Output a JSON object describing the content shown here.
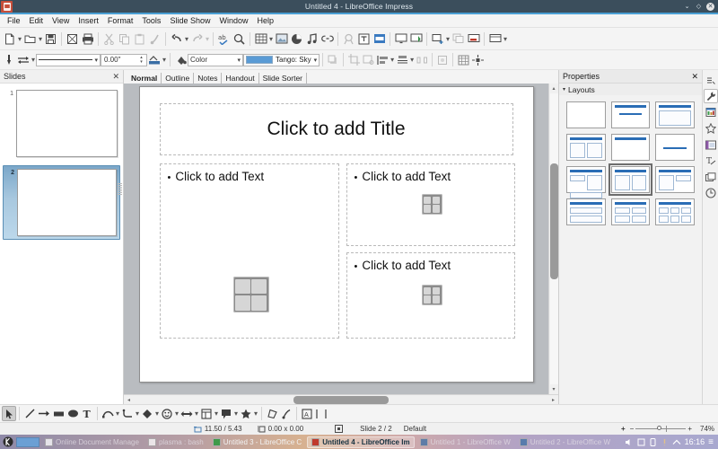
{
  "window": {
    "title": "Untitled 4 - LibreOffice Impress",
    "app_icon": "impress-document-icon",
    "controls": {
      "minimize": "⌄",
      "maximize": "◇",
      "close": "✕"
    }
  },
  "menubar": {
    "items": [
      {
        "label": "File"
      },
      {
        "label": "Edit"
      },
      {
        "label": "View"
      },
      {
        "label": "Insert"
      },
      {
        "label": "Format"
      },
      {
        "label": "Tools"
      },
      {
        "label": "Slide Show"
      },
      {
        "label": "Window"
      },
      {
        "label": "Help"
      }
    ]
  },
  "toolbar_main": {
    "items": [
      {
        "name": "new-document",
        "dropdown": true
      },
      {
        "name": "open-document",
        "dropdown": true
      },
      {
        "name": "save-document",
        "dropdown": false
      },
      {
        "name": "export-pdf",
        "dropdown": false
      },
      {
        "name": "print",
        "dropdown": false
      },
      {
        "name": "cut",
        "disabled": true
      },
      {
        "name": "copy",
        "disabled": true
      },
      {
        "name": "paste",
        "disabled": true
      },
      {
        "name": "clone-formatting",
        "disabled": true
      },
      {
        "name": "undo",
        "dropdown": true
      },
      {
        "name": "redo",
        "dropdown": true,
        "disabled": true
      },
      {
        "name": "spelling"
      },
      {
        "name": "find-replace"
      },
      {
        "name": "insert-table",
        "dropdown": true
      },
      {
        "name": "insert-image"
      },
      {
        "name": "insert-chart"
      },
      {
        "name": "insert-audio-video"
      },
      {
        "name": "insert-hyperlink"
      },
      {
        "name": "insert-special-character",
        "disabled": true
      },
      {
        "name": "insert-text-box"
      },
      {
        "name": "insert-header-footer"
      },
      {
        "name": "start-from-first-slide"
      },
      {
        "name": "start-from-current-slide"
      },
      {
        "name": "new-slide",
        "dropdown": true
      },
      {
        "name": "duplicate-slide",
        "disabled": true
      },
      {
        "name": "delete-slide"
      },
      {
        "name": "slide-layout",
        "dropdown": true
      }
    ]
  },
  "toolbar_line_fill": {
    "line_style_value": "—————",
    "line_width_value": "0.00\"",
    "fill_type_value": "Color",
    "fill_color_name": "Tango: Sky",
    "fill_color_hex": "#5a9bd5",
    "items": [
      {
        "name": "line-endpoint-style"
      },
      {
        "name": "line-arrow-style",
        "dropdown": true
      },
      {
        "name": "line-corner-style",
        "dropdown": true
      },
      {
        "name": "shadow"
      },
      {
        "name": "crop-image"
      },
      {
        "name": "filter"
      },
      {
        "name": "rotate"
      },
      {
        "name": "align-objects",
        "dropdown": true
      },
      {
        "name": "arrange-objects",
        "dropdown": true
      },
      {
        "name": "distribute-selection",
        "disabled": true
      },
      {
        "name": "shadow-toggle"
      },
      {
        "name": "display-grid"
      },
      {
        "name": "snap-to-grid"
      }
    ]
  },
  "slides_panel": {
    "title": "Slides",
    "close_icon": "✕",
    "slides": [
      {
        "number": "1",
        "selected": false
      },
      {
        "number": "2",
        "selected": true
      }
    ]
  },
  "view_tabs": [
    {
      "label": "Normal",
      "active": true
    },
    {
      "label": "Outline",
      "active": false
    },
    {
      "label": "Notes",
      "active": false
    },
    {
      "label": "Handout",
      "active": false
    },
    {
      "label": "Slide Sorter",
      "active": false
    }
  ],
  "slide_canvas": {
    "title_placeholder": "Click to add Title",
    "content_left": {
      "text": "Click to add Text",
      "bullet": "•",
      "object_icon": "insert-object-icon"
    },
    "content_right_top": {
      "text": "Click to add Text",
      "bullet": "•",
      "object_icon": "insert-object-icon"
    },
    "content_right_bottom": {
      "text": "Click to add Text",
      "bullet": "•",
      "object_icon": "insert-object-icon"
    }
  },
  "properties_panel": {
    "title": "Properties",
    "close_icon": "✕",
    "section_caret": "▾",
    "section_title": "Layouts",
    "layouts": [
      {
        "name": "blank-slide",
        "selected": false
      },
      {
        "name": "title-content",
        "selected": false
      },
      {
        "name": "title-only",
        "selected": false
      },
      {
        "name": "title-two-content",
        "selected": false
      },
      {
        "name": "title-content-blank",
        "selected": false
      },
      {
        "name": "centered-text",
        "selected": false
      },
      {
        "name": "title-two-content-stacked",
        "selected": false
      },
      {
        "name": "title-content-over-two",
        "selected": true
      },
      {
        "name": "title-two-content-over",
        "selected": false
      },
      {
        "name": "title-three-rows",
        "selected": false
      },
      {
        "name": "title-four-content",
        "selected": false
      },
      {
        "name": "title-six-content",
        "selected": false
      }
    ],
    "rail_icons": [
      {
        "name": "sidebar-settings-icon",
        "active": false
      },
      {
        "name": "properties-icon",
        "active": true
      },
      {
        "name": "slide-transition-icon",
        "active": false
      },
      {
        "name": "animation-icon",
        "active": false
      },
      {
        "name": "master-slides-icon",
        "active": false
      },
      {
        "name": "styles-icon",
        "active": false
      },
      {
        "name": "gallery-icon",
        "active": false
      },
      {
        "name": "navigator-icon",
        "active": false
      }
    ]
  },
  "drawing_toolbar": {
    "items": [
      {
        "name": "select-tool",
        "active": true
      },
      {
        "name": "line-tool"
      },
      {
        "name": "line-ends-with-arrow-tool"
      },
      {
        "name": "rectangle-tool"
      },
      {
        "name": "ellipse-tool"
      },
      {
        "name": "insert-text-box-tool"
      },
      {
        "name": "curves-and-polygons-tool",
        "dropdown": true
      },
      {
        "name": "connectors-tool",
        "dropdown": true
      },
      {
        "name": "basic-shapes-tool",
        "dropdown": true
      },
      {
        "name": "symbol-shapes-tool",
        "dropdown": true
      },
      {
        "name": "block-arrows-tool",
        "dropdown": true
      },
      {
        "name": "flowchart-shapes-tool",
        "dropdown": true
      },
      {
        "name": "callout-shapes-tool",
        "dropdown": true
      },
      {
        "name": "stars-and-banners-tool",
        "dropdown": true
      },
      {
        "name": "rotate-tool"
      },
      {
        "name": "points-tool"
      },
      {
        "name": "toggle-extrusion-tool"
      },
      {
        "name": "distribute-tool"
      }
    ]
  },
  "statusbar": {
    "cursor_position": "11.50 / 5.43",
    "object_size": "0.00 x 0.00",
    "cursor_icon": "position-icon",
    "size_icon": "size-icon",
    "selection_icon": "selection-mode-icon",
    "slide_info": "Slide 2 / 2",
    "master_name": "Default",
    "zoom_out": "−",
    "zoom_in": "+",
    "fit_icon": "+",
    "zoom_level": "74%"
  },
  "taskbar": {
    "start_icon": "kde-start-icon",
    "items": [
      {
        "label": "Online Document Manage",
        "icon": "globe-icon",
        "state": "ghost"
      },
      {
        "label": "plasma : bash",
        "icon": "terminal-icon",
        "state": "ghost"
      },
      {
        "label": "Untitled 3 - LibreOffice C",
        "icon": "calc-icon",
        "state": "normal"
      },
      {
        "label": "Untitled 4 - LibreOffice Im",
        "icon": "impress-icon",
        "state": "active"
      },
      {
        "label": "Untitled 1 - LibreOffice W",
        "icon": "writer-icon",
        "state": "ghost"
      },
      {
        "label": "Untitled 2 - LibreOffice W",
        "icon": "writer-icon",
        "state": "ghost"
      }
    ],
    "tray": [
      {
        "name": "volume-icon"
      },
      {
        "name": "clipboard-icon"
      },
      {
        "name": "device-icon"
      },
      {
        "name": "notification-icon"
      },
      {
        "name": "show-hidden-icon"
      }
    ],
    "clock": "16:16",
    "menu_icon": "≡"
  }
}
